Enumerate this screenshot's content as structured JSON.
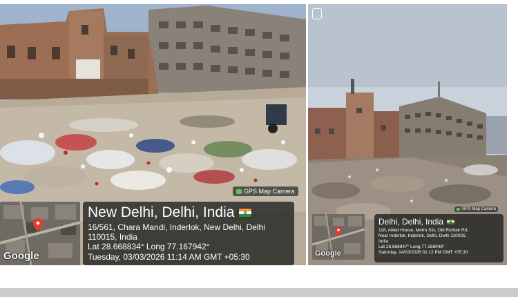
{
  "left_photo": {
    "gps_tag": "GPS Map Camera",
    "map_logo": "Google",
    "map_pin_color": "#e53935",
    "stamp": {
      "title": "New Delhi, Delhi, India",
      "address_line1": "16/561, Chara Mandi, Inderlok, New Delhi, Delhi",
      "address_line2": "110015, India",
      "coordinates": "Lat 28.668834° Long 77.167942°",
      "datetime": "Tuesday, 03/03/2026 11:14 AM GMT +05:30"
    }
  },
  "right_photo": {
    "gps_tag": "GPS Map Camera",
    "map_logo": "Google",
    "map_pin_color": "#e53935",
    "stamp": {
      "title": "Delhi, Delhi, India",
      "address_line1": "118, Allied House, Metro Stn, Old Rohtak Rd,",
      "address_line2": "Near Inderlok, Inderlok, Delhi, Delhi 110035,",
      "address_line3": "India",
      "coordinates": "Lat 28.668847° Long 77.168048°",
      "datetime": "Saturday, 14/03/2026 01:12 PM GMT +05:30"
    }
  },
  "icons": {
    "flag": "india-flag-icon",
    "camera": "camera-icon",
    "pin": "map-pin-icon",
    "corner": "phone-frame-icon"
  }
}
